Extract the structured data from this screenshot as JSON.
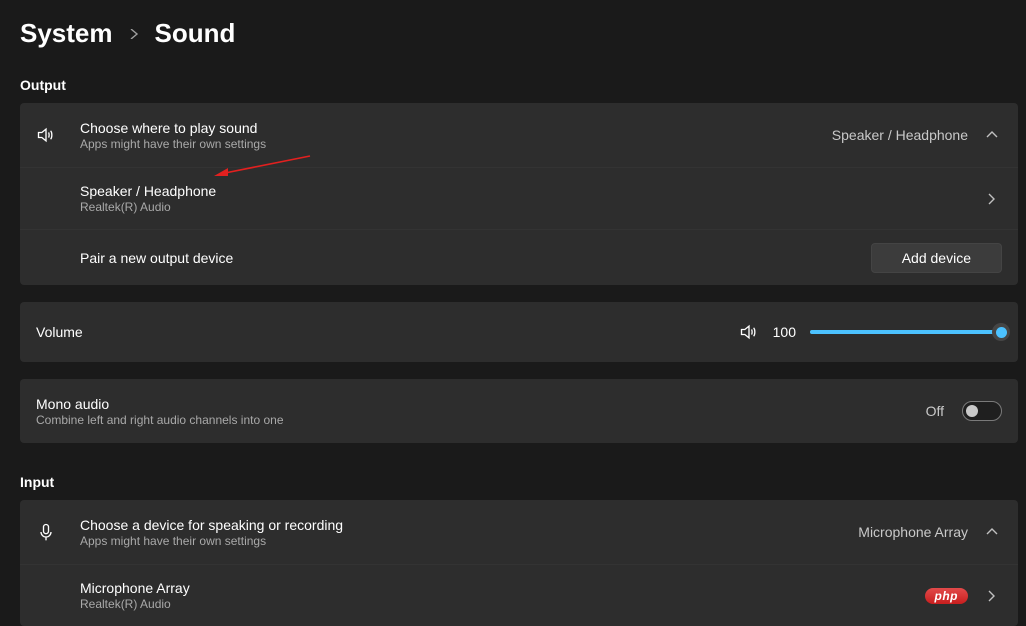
{
  "breadcrumb": {
    "parent": "System",
    "current": "Sound"
  },
  "output": {
    "label": "Output",
    "choose": {
      "title": "Choose where to play sound",
      "subtitle": "Apps might have their own settings",
      "value": "Speaker / Headphone"
    },
    "device": {
      "title": "Speaker / Headphone",
      "subtitle": "Realtek(R) Audio"
    },
    "pair": {
      "title": "Pair a new output device",
      "button": "Add device"
    },
    "volume": {
      "label": "Volume",
      "value": "100",
      "percent": 100
    },
    "mono": {
      "title": "Mono audio",
      "subtitle": "Combine left and right audio channels into one",
      "state": "Off"
    }
  },
  "input": {
    "label": "Input",
    "choose": {
      "title": "Choose a device for speaking or recording",
      "subtitle": "Apps might have their own settings",
      "value": "Microphone Array"
    },
    "device": {
      "title": "Microphone Array",
      "subtitle": "Realtek(R) Audio"
    }
  },
  "badge": "php"
}
